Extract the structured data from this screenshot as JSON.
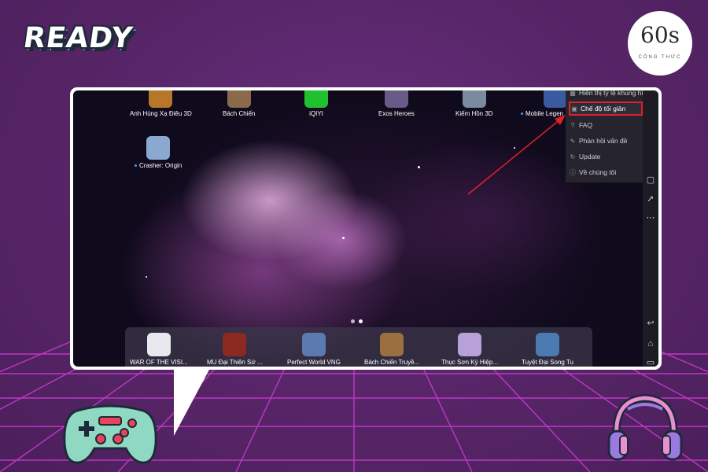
{
  "badge": {
    "text": "READY"
  },
  "logo": {
    "main": "60s",
    "sub": "CÔNG THỨC"
  },
  "top_apps": [
    {
      "label": "Anh Hùng Xạ Điêu 3D",
      "color": "#b8762a",
      "dot": false
    },
    {
      "label": "Bách Chiến",
      "color": "#8a6a4a",
      "dot": false
    },
    {
      "label": "iQIYI",
      "color": "#20c030",
      "dot": false
    },
    {
      "label": "Exos Heroes",
      "color": "#6a5a8a",
      "dot": false
    },
    {
      "label": "Kiếm Hồn 3D",
      "color": "#7a8aa0",
      "dot": false
    },
    {
      "label": "Mobile Legen",
      "color": "#3a5aa0",
      "dot": true
    }
  ],
  "mid_app": {
    "label": "Crasher: Origin",
    "color": "#8aa8d0",
    "dot": true
  },
  "dock_apps": [
    {
      "label": "WAR OF THE VISI...",
      "color": "#e8e8ee"
    },
    {
      "label": "MU Đại Thiên Sứ ...",
      "color": "#8a2a20"
    },
    {
      "label": "Perfect World VNG",
      "color": "#5a7ab0"
    },
    {
      "label": "Bách Chiến Truyề...",
      "color": "#9a7040"
    },
    {
      "label": "Thục Sơn Kỳ Hiệp...",
      "color": "#b8a0d8"
    },
    {
      "label": "Tuyệt Đại Song Tu",
      "color": "#4a7ab0"
    }
  ],
  "menu": {
    "items": [
      {
        "label": "Hiển thị tỷ lệ khung hìn",
        "icon": "display-ratio-icon",
        "glyph": "▦"
      },
      {
        "label": "Chế độ tối giản",
        "icon": "minimal-mode-icon",
        "glyph": "▣"
      },
      {
        "label": "FAQ",
        "icon": "faq-icon",
        "glyph": "?"
      },
      {
        "label": "Phản hồi vấn đề",
        "icon": "feedback-icon",
        "glyph": "✎"
      },
      {
        "label": "Update",
        "icon": "update-icon",
        "glyph": "↻"
      },
      {
        "label": "Về chúng tôi",
        "icon": "info-icon",
        "glyph": "ⓘ"
      }
    ],
    "highlight_color": "#e0202a"
  },
  "sidebar_icons": [
    "rocket-icon",
    "more-icon",
    "back-icon",
    "home-icon",
    "recent-apps-icon"
  ],
  "colors": {
    "background": "#5a2a6e",
    "grid": "#d23ad8",
    "arrow": "#e0202a"
  }
}
